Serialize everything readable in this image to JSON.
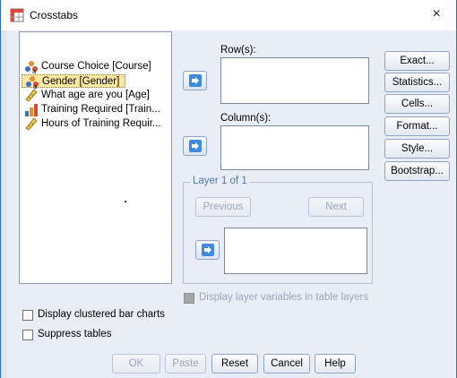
{
  "window": {
    "title": "Crosstabs",
    "close_glyph": "×"
  },
  "variables": [
    {
      "label": "Course Choice [Course]",
      "icon": "nominal-icon",
      "selected": false
    },
    {
      "label": "Gender [Gender]",
      "icon": "nominal-icon",
      "selected": true
    },
    {
      "label": "What age are you [Age]",
      "icon": "scale-icon",
      "selected": false
    },
    {
      "label": "Training Required [Train...",
      "icon": "ordinal-icon",
      "selected": false
    },
    {
      "label": "Hours of Training Requir...",
      "icon": "scale-icon",
      "selected": false
    }
  ],
  "rows": {
    "label": "Row(s):"
  },
  "columns": {
    "label": "Column(s):"
  },
  "layer": {
    "label": "Layer 1 of 1",
    "previous": "Previous",
    "next": "Next"
  },
  "side_buttons": [
    "Exact...",
    "Statistics...",
    "Cells...",
    "Format...",
    "Style...",
    "Bootstrap..."
  ],
  "options": {
    "display_layer": "Display layer variables in table layers",
    "clustered_bar": "Display clustered bar charts",
    "suppress_tables": "Suppress tables"
  },
  "footer_buttons": {
    "ok": "OK",
    "paste": "Paste",
    "reset": "Reset",
    "cancel": "Cancel",
    "help": "Help"
  },
  "colors": {
    "accent": "#3d8be0",
    "selected_item": "#fce7a3",
    "dialog_bg": "#e9eef6"
  }
}
